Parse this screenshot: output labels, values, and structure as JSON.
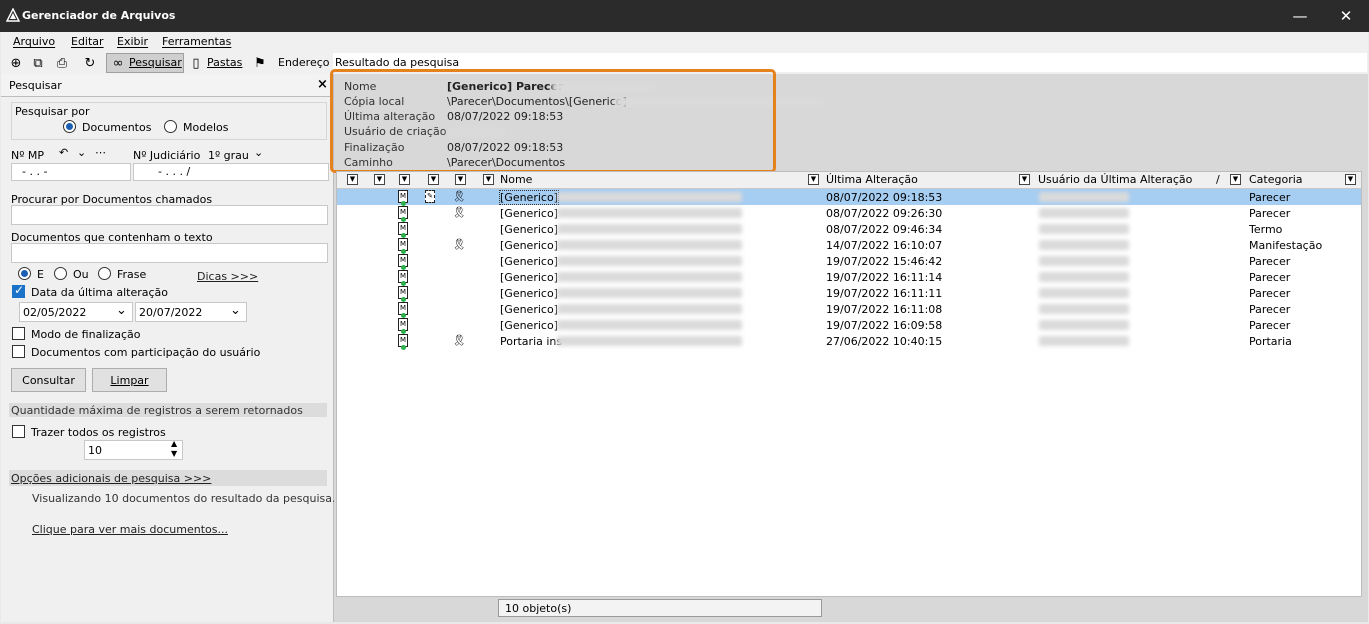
{
  "window": {
    "title": "Gerenciador de Arquivos",
    "minimize": "—",
    "close": "✕"
  },
  "menu": [
    "Arquivo",
    "Editar",
    "Exibir",
    "Ferramentas"
  ],
  "toolbar": {
    "search": "Pesquisar",
    "folders": "Pastas",
    "address": "Endereço",
    "address_value": "Resultado da pesquisa"
  },
  "left": {
    "panel_title": "Pesquisar",
    "close": "×",
    "search_by": "Pesquisar por",
    "opt_documents": "Documentos",
    "opt_models": "Modelos",
    "mp_label": "Nº MP",
    "mp_extra": "⋯",
    "judicial_label": "Nº Judiciário",
    "grau": "1º grau",
    "mp_value": "- . . -",
    "jud_value": "- . . . /",
    "procurar": "Procurar por Documentos chamados",
    "contem": "Documentos que contenham o texto",
    "logic_e": "E",
    "logic_ou": "Ou",
    "logic_frase": "Frase",
    "dicas": "Dicas >>>",
    "data_ultima": "Data da última alteração",
    "date_from": "02/05/2022",
    "date_to": "20/07/2022",
    "modo_final": "Modo de finalização",
    "participacao": "Documentos com participação do usuário",
    "consultar": "Consultar",
    "limpar": "Limpar",
    "qtd_max": "Quantidade máxima de registros a serem retornados",
    "trazer_todos": "Trazer todos os registros",
    "max_value": "10",
    "opcoes": "Opções adicionais de pesquisa >>>",
    "visualizando": "Visualizando 10 documentos do resultado da pesquisa.",
    "clique": "Clique para ver mais documentos..."
  },
  "info": {
    "nome_label": "Nome",
    "nome_value": "[Generico] Parecer",
    "copia_label": "Cópia local",
    "copia_value": "\\Parecer\\Documentos\\[Generico]",
    "ultima_label": "Última alteração",
    "ultima_value": "08/07/2022 09:18:53",
    "usuario_label": "Usuário de criação",
    "final_label": "Finalização",
    "final_value": "08/07/2022 09:18:53",
    "caminho_label": "Caminho",
    "caminho_value": "\\Parecer\\Documentos"
  },
  "table": {
    "headers": {
      "nome": "Nome",
      "ultima": "Última Alteração",
      "usuario": "Usuário da Última Alteração",
      "usuario_sort": "/",
      "categoria": "Categoria"
    },
    "rows": [
      {
        "nome": "[Generico]",
        "data": "08/07/2022 09:18:53",
        "categoria": "Parecer",
        "selected": true,
        "sig": true,
        "ribbon": true
      },
      {
        "nome": "[Generico]",
        "data": "08/07/2022 09:26:30",
        "categoria": "Parecer",
        "selected": false,
        "sig": false,
        "ribbon": true
      },
      {
        "nome": "[Generico]",
        "data": "08/07/2022 09:46:34",
        "categoria": "Termo",
        "selected": false,
        "sig": false,
        "ribbon": false
      },
      {
        "nome": "[Generico]",
        "data": "14/07/2022 16:10:07",
        "categoria": "Manifestação",
        "selected": false,
        "sig": false,
        "ribbon": true
      },
      {
        "nome": "[Generico]",
        "data": "19/07/2022 15:46:42",
        "categoria": "Parecer",
        "selected": false,
        "sig": false,
        "ribbon": false
      },
      {
        "nome": "[Generico]",
        "data": "19/07/2022 16:11:14",
        "categoria": "Parecer",
        "selected": false,
        "sig": false,
        "ribbon": false
      },
      {
        "nome": "[Generico]",
        "data": "19/07/2022 16:11:11",
        "categoria": "Parecer",
        "selected": false,
        "sig": false,
        "ribbon": false
      },
      {
        "nome": "[Generico]",
        "data": "19/07/2022 16:11:08",
        "categoria": "Parecer",
        "selected": false,
        "sig": false,
        "ribbon": false
      },
      {
        "nome": "[Generico]",
        "data": "19/07/2022 16:09:58",
        "categoria": "Parecer",
        "selected": false,
        "sig": false,
        "ribbon": false
      },
      {
        "nome": "Portaria ins",
        "data": "27/06/2022 10:40:15",
        "categoria": "Portaria",
        "selected": false,
        "sig": false,
        "ribbon": true
      }
    ]
  },
  "status": "10 objeto(s)"
}
